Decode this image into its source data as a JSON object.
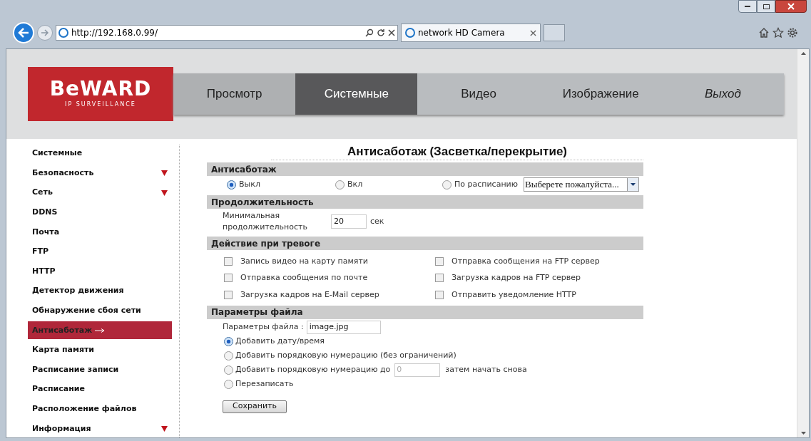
{
  "browser": {
    "url": "http://192.168.0.99/",
    "tab_title": "network HD Camera"
  },
  "logo": {
    "brand": "BeWARD",
    "tagline": "IP SURVEILLANCE"
  },
  "nav": [
    {
      "label": "Просмотр",
      "selected": false,
      "kind": "tab"
    },
    {
      "label": "Системные",
      "selected": true,
      "kind": "tab"
    },
    {
      "label": "Видео",
      "selected": false,
      "kind": "tab"
    },
    {
      "label": "Изображение",
      "selected": false,
      "kind": "tab"
    },
    {
      "label": "Выход",
      "selected": false,
      "kind": "exit"
    }
  ],
  "sidebar": {
    "items": [
      {
        "label": "Системные",
        "selected": false,
        "expandable": false
      },
      {
        "label": "Безопасность",
        "selected": false,
        "expandable": true
      },
      {
        "label": "Сеть",
        "selected": false,
        "expandable": true
      },
      {
        "label": "DDNS",
        "selected": false,
        "expandable": false
      },
      {
        "label": "Почта",
        "selected": false,
        "expandable": false
      },
      {
        "label": "FTP",
        "selected": false,
        "expandable": false
      },
      {
        "label": "HTTP",
        "selected": false,
        "expandable": false
      },
      {
        "label": "Детектор движения",
        "selected": false,
        "expandable": false
      },
      {
        "label": "Обнаружение сбоя сети",
        "selected": false,
        "expandable": false
      },
      {
        "label": "Антисаботаж",
        "selected": true,
        "expandable": false
      },
      {
        "label": "Карта памяти",
        "selected": false,
        "expandable": false
      },
      {
        "label": "Расписание записи",
        "selected": false,
        "expandable": false
      },
      {
        "label": "Расписание",
        "selected": false,
        "expandable": false
      },
      {
        "label": "Расположение файлов",
        "selected": false,
        "expandable": false
      },
      {
        "label": "Информация",
        "selected": false,
        "expandable": true
      }
    ]
  },
  "page_title": "Антисаботаж (Засветка/перекрытие)",
  "sections": [
    {
      "kind": "radios",
      "title": "Антисаботаж",
      "options": [
        {
          "label": "Выкл",
          "selected": true
        },
        {
          "label": "Вкл",
          "selected": false
        },
        {
          "label": "По расписанию",
          "selected": false
        }
      ],
      "select": {
        "value": "Выберете пожалуйста..."
      }
    },
    {
      "kind": "duration",
      "title": "Продолжительность",
      "label": "Минимальная продолжительность",
      "value": "20",
      "unit": "сек"
    },
    {
      "kind": "checkboxes",
      "title": "Действие при тревоге",
      "options": [
        {
          "label": "Запись видео на карту памяти",
          "checked": false
        },
        {
          "label": "Отправка сообщения на FTP сервер",
          "checked": false
        },
        {
          "label": "Отправка сообщения по почте",
          "checked": false
        },
        {
          "label": "Загрузка кадров на FTP сервер",
          "checked": false
        },
        {
          "label": "Загрузка кадров на E-Mail сервер",
          "checked": false
        },
        {
          "label": "Отправить уведомление HTTP",
          "checked": false
        }
      ]
    },
    {
      "kind": "file",
      "title": "Параметры файла",
      "label": "Параметры файла :",
      "value": "image.jpg",
      "options": [
        {
          "label": "Добавить дату/время",
          "selected": true
        },
        {
          "label": "Добавить порядковую нумерацию (без ограничений)",
          "selected": false
        },
        {
          "label": "Добавить порядковую нумерацию до",
          "selected": false,
          "input": "0",
          "suffix": "затем начать снова"
        },
        {
          "label": "Перезаписать",
          "selected": false
        }
      ]
    }
  ],
  "save_button": "Сохранить"
}
